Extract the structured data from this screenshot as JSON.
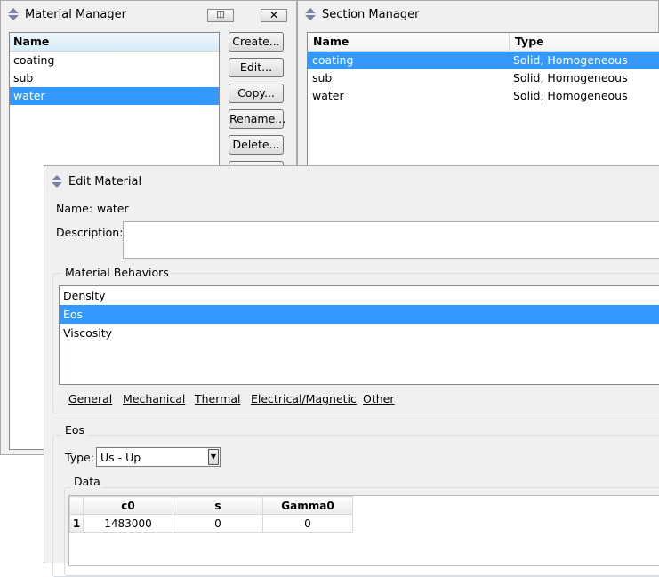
{
  "material_manager": {
    "title": "Material Manager",
    "column_header": "Name",
    "items": [
      "coating",
      "sub",
      "water"
    ],
    "selected": "water",
    "buttons": {
      "create": "Create...",
      "edit": "Edit...",
      "copy": "Copy...",
      "rename": "Rename...",
      "delete": "Delete..."
    }
  },
  "section_manager": {
    "title": "Section Manager",
    "columns": [
      "Name",
      "Type"
    ],
    "rows": [
      {
        "name": "coating",
        "type": "Solid, Homogeneous"
      },
      {
        "name": "sub",
        "type": "Solid, Homogeneous"
      },
      {
        "name": "water",
        "type": "Solid, Homogeneous"
      }
    ],
    "selected": "coating"
  },
  "edit_material": {
    "title": "Edit Material",
    "name_label": "Name:",
    "name_value": "water",
    "description_label": "Description:",
    "description_value": "",
    "behaviors_label": "Material Behaviors",
    "behaviors": [
      "Density",
      "Eos",
      "Viscosity"
    ],
    "selected_behavior": "Eos",
    "tabs": [
      "General",
      "Mechanical",
      "Thermal",
      "Electrical/Magnetic",
      "Other"
    ],
    "eos_label": "Eos",
    "type_label": "Type:",
    "type_value": "Us - Up",
    "data_label": "Data",
    "data_columns": [
      "c0",
      "s",
      "Gamma0"
    ],
    "data_rows": [
      {
        "index": "1",
        "c0": "1483000",
        "s": "0",
        "Gamma0": "0"
      }
    ]
  },
  "icons": {
    "app_icon": "abaqus-arrows-icon",
    "restore": "restore-icon",
    "close": "close-icon",
    "dropdown": "dropdown-arrow-icon"
  },
  "colors": {
    "selection": "#3399ff",
    "window_bg": "#f0f0f0"
  }
}
